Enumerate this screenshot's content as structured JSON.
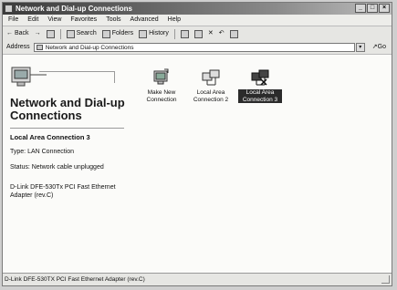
{
  "window": {
    "title": "Network and Dial-up Connections"
  },
  "menu": [
    "File",
    "Edit",
    "View",
    "Favorites",
    "Tools",
    "Advanced",
    "Help"
  ],
  "toolbar": {
    "back": "Back",
    "search": "Search",
    "folders": "Folders",
    "history": "History"
  },
  "address": {
    "label": "Address",
    "value": "Network and Dial-up Connections",
    "go": "Go"
  },
  "leftpane": {
    "title": "Network and Dial-up Connections",
    "connection_name": "Local Area Connection 3",
    "type": "Type: LAN Connection",
    "status": "Status: Network cable unplugged",
    "adapter": "D-Link DFE-530Tx PCI Fast Ethernet Adapter (rev.C)"
  },
  "items": [
    {
      "label": "Make New Connection",
      "icon": "make-new-connection-icon",
      "selected": false
    },
    {
      "label": "Local Area Connection 2",
      "icon": "lan-connection-icon",
      "selected": false
    },
    {
      "label": "Local Area Connection 3",
      "icon": "lan-connection-disconnected-icon",
      "selected": true
    }
  ],
  "statusbar": {
    "text": "D-Link DFE-530TX PCI Fast Ethernet Adapter (rev.C)"
  }
}
